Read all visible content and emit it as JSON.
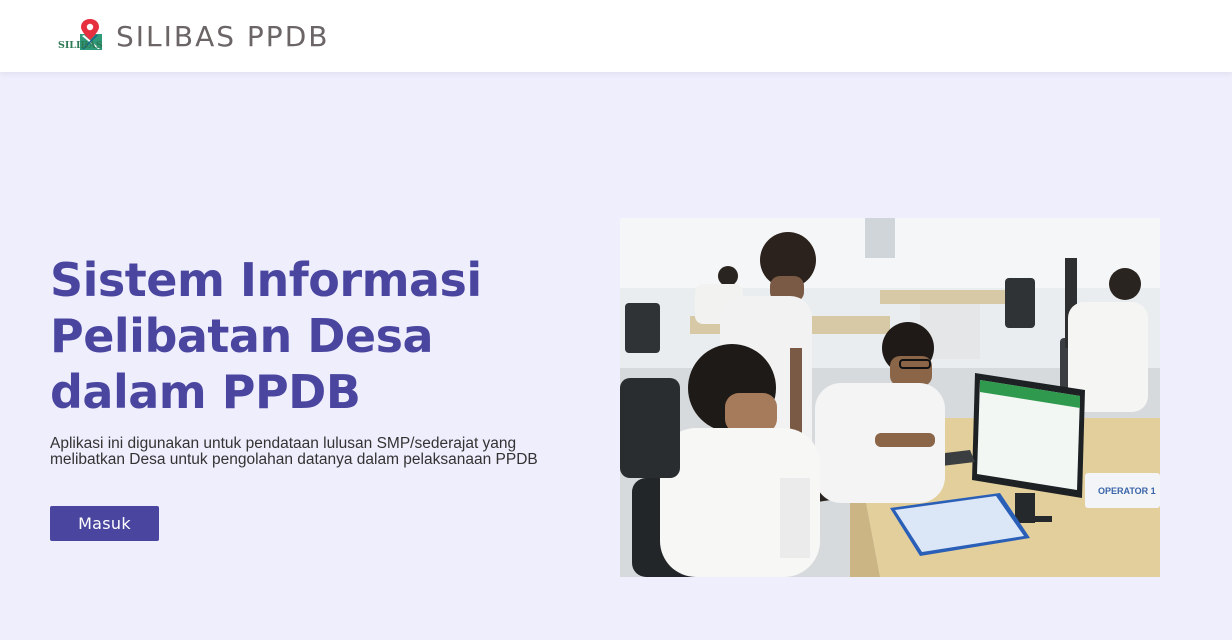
{
  "navbar": {
    "logo_icon": "map-pin-logo-icon",
    "logo_text": "SILIBAS",
    "brand_name": "SILIBAS PPDB"
  },
  "hero": {
    "title": "Sistem Informasi Pelibatan Desa dalam PPDB",
    "description": "Aplikasi ini digunakan untuk pendataan lulusan SMP/sederajat yang melibatkan Desa untuk pengolahan datanya dalam pelaksanaan PPDB",
    "button_label": "Masuk",
    "image": {
      "description": "office-workers-at-computers-photo",
      "sign_text": "OPERATOR 1"
    }
  },
  "colors": {
    "accent": "#4a46a0",
    "background": "#efeefd",
    "navbar_bg": "#ffffff",
    "brand_text": "#6b6665"
  }
}
